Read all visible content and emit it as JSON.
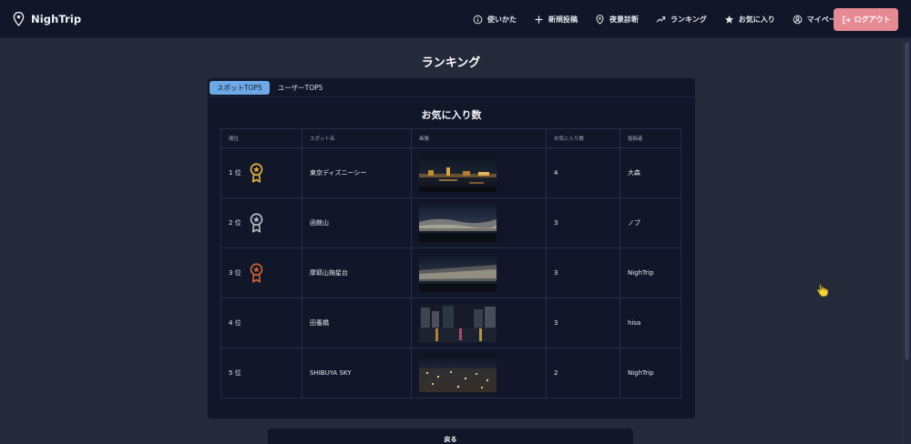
{
  "brand": {
    "name": "NighTrip"
  },
  "nav": {
    "items": [
      {
        "label": "使いかた",
        "icon": "info-icon"
      },
      {
        "label": "新規投稿",
        "icon": "plus-icon"
      },
      {
        "label": "夜景診断",
        "icon": "location-icon"
      },
      {
        "label": "ランキング",
        "icon": "trending-icon"
      },
      {
        "label": "お気に入り",
        "icon": "star-icon"
      },
      {
        "label": "マイページ",
        "icon": "user-icon"
      }
    ],
    "logout_label": "ログアウト"
  },
  "page": {
    "title": "ランキング"
  },
  "tabs": [
    {
      "label": "スポットTOP5",
      "active": true
    },
    {
      "label": "ユーザーTOP5",
      "active": false
    }
  ],
  "ranking": {
    "title": "お気に入り数",
    "headers": [
      "順位",
      "スポット名",
      "画像",
      "お気に入り数",
      "投稿者"
    ],
    "rows": [
      {
        "rank": "1 位",
        "medal": "gold",
        "spot": "東京ディズニーシー",
        "favorites": "4",
        "author": "大森"
      },
      {
        "rank": "2 位",
        "medal": "silver",
        "spot": "函館山",
        "favorites": "3",
        "author": "ノブ"
      },
      {
        "rank": "3 位",
        "medal": "bronze",
        "spot": "摩耶山掬星台",
        "favorites": "3",
        "author": "NighTrip"
      },
      {
        "rank": "4 位",
        "medal": null,
        "spot": "田養橋",
        "favorites": "3",
        "author": "hisa"
      },
      {
        "rank": "5 位",
        "medal": null,
        "spot": "SHIBUYA SKY",
        "favorites": "2",
        "author": "NighTrip"
      }
    ]
  },
  "back_label": "戻る",
  "colors": {
    "background": "#252a3b",
    "navbar": "#111629",
    "card": "#111629",
    "active_tab": "#6ea9e7",
    "logout": "#e58a92",
    "gold": "#e2b23a",
    "silver": "#b8bcc8",
    "bronze": "#c9623a"
  }
}
